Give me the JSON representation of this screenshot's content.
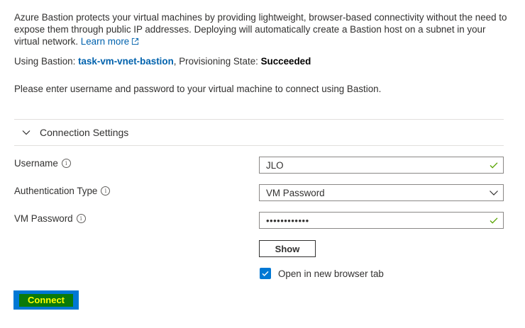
{
  "intro": {
    "text": "Azure Bastion protects your virtual machines by providing lightweight, browser-based connectivity without the need to expose them through public IP addresses. Deploying will automatically create a Bastion host on a subnet in your virtual network.",
    "learn_more": "Learn more"
  },
  "using": {
    "prefix": "Using Bastion:",
    "bastion_name": "task-vm-vnet-bastion",
    "state_label": ", Provisioning State:",
    "state_value": "Succeeded"
  },
  "instructions": "Please enter username and password to your virtual machine to connect using Bastion.",
  "section": {
    "title": "Connection Settings"
  },
  "form": {
    "username_label": "Username",
    "username_value": "JLO",
    "auth_type_label": "Authentication Type",
    "auth_type_value": "VM Password",
    "password_label": "VM Password",
    "password_value": "••••••••••••",
    "show_label": "Show",
    "open_new_tab_label": "Open in new browser tab",
    "open_new_tab_checked": true
  },
  "connect_label": "Connect",
  "colors": {
    "link": "#0062ad",
    "accent": "#0078d4",
    "connect_bg": "#0a7a0a",
    "connect_text": "#ffff00",
    "valid_check": "#57a300"
  }
}
